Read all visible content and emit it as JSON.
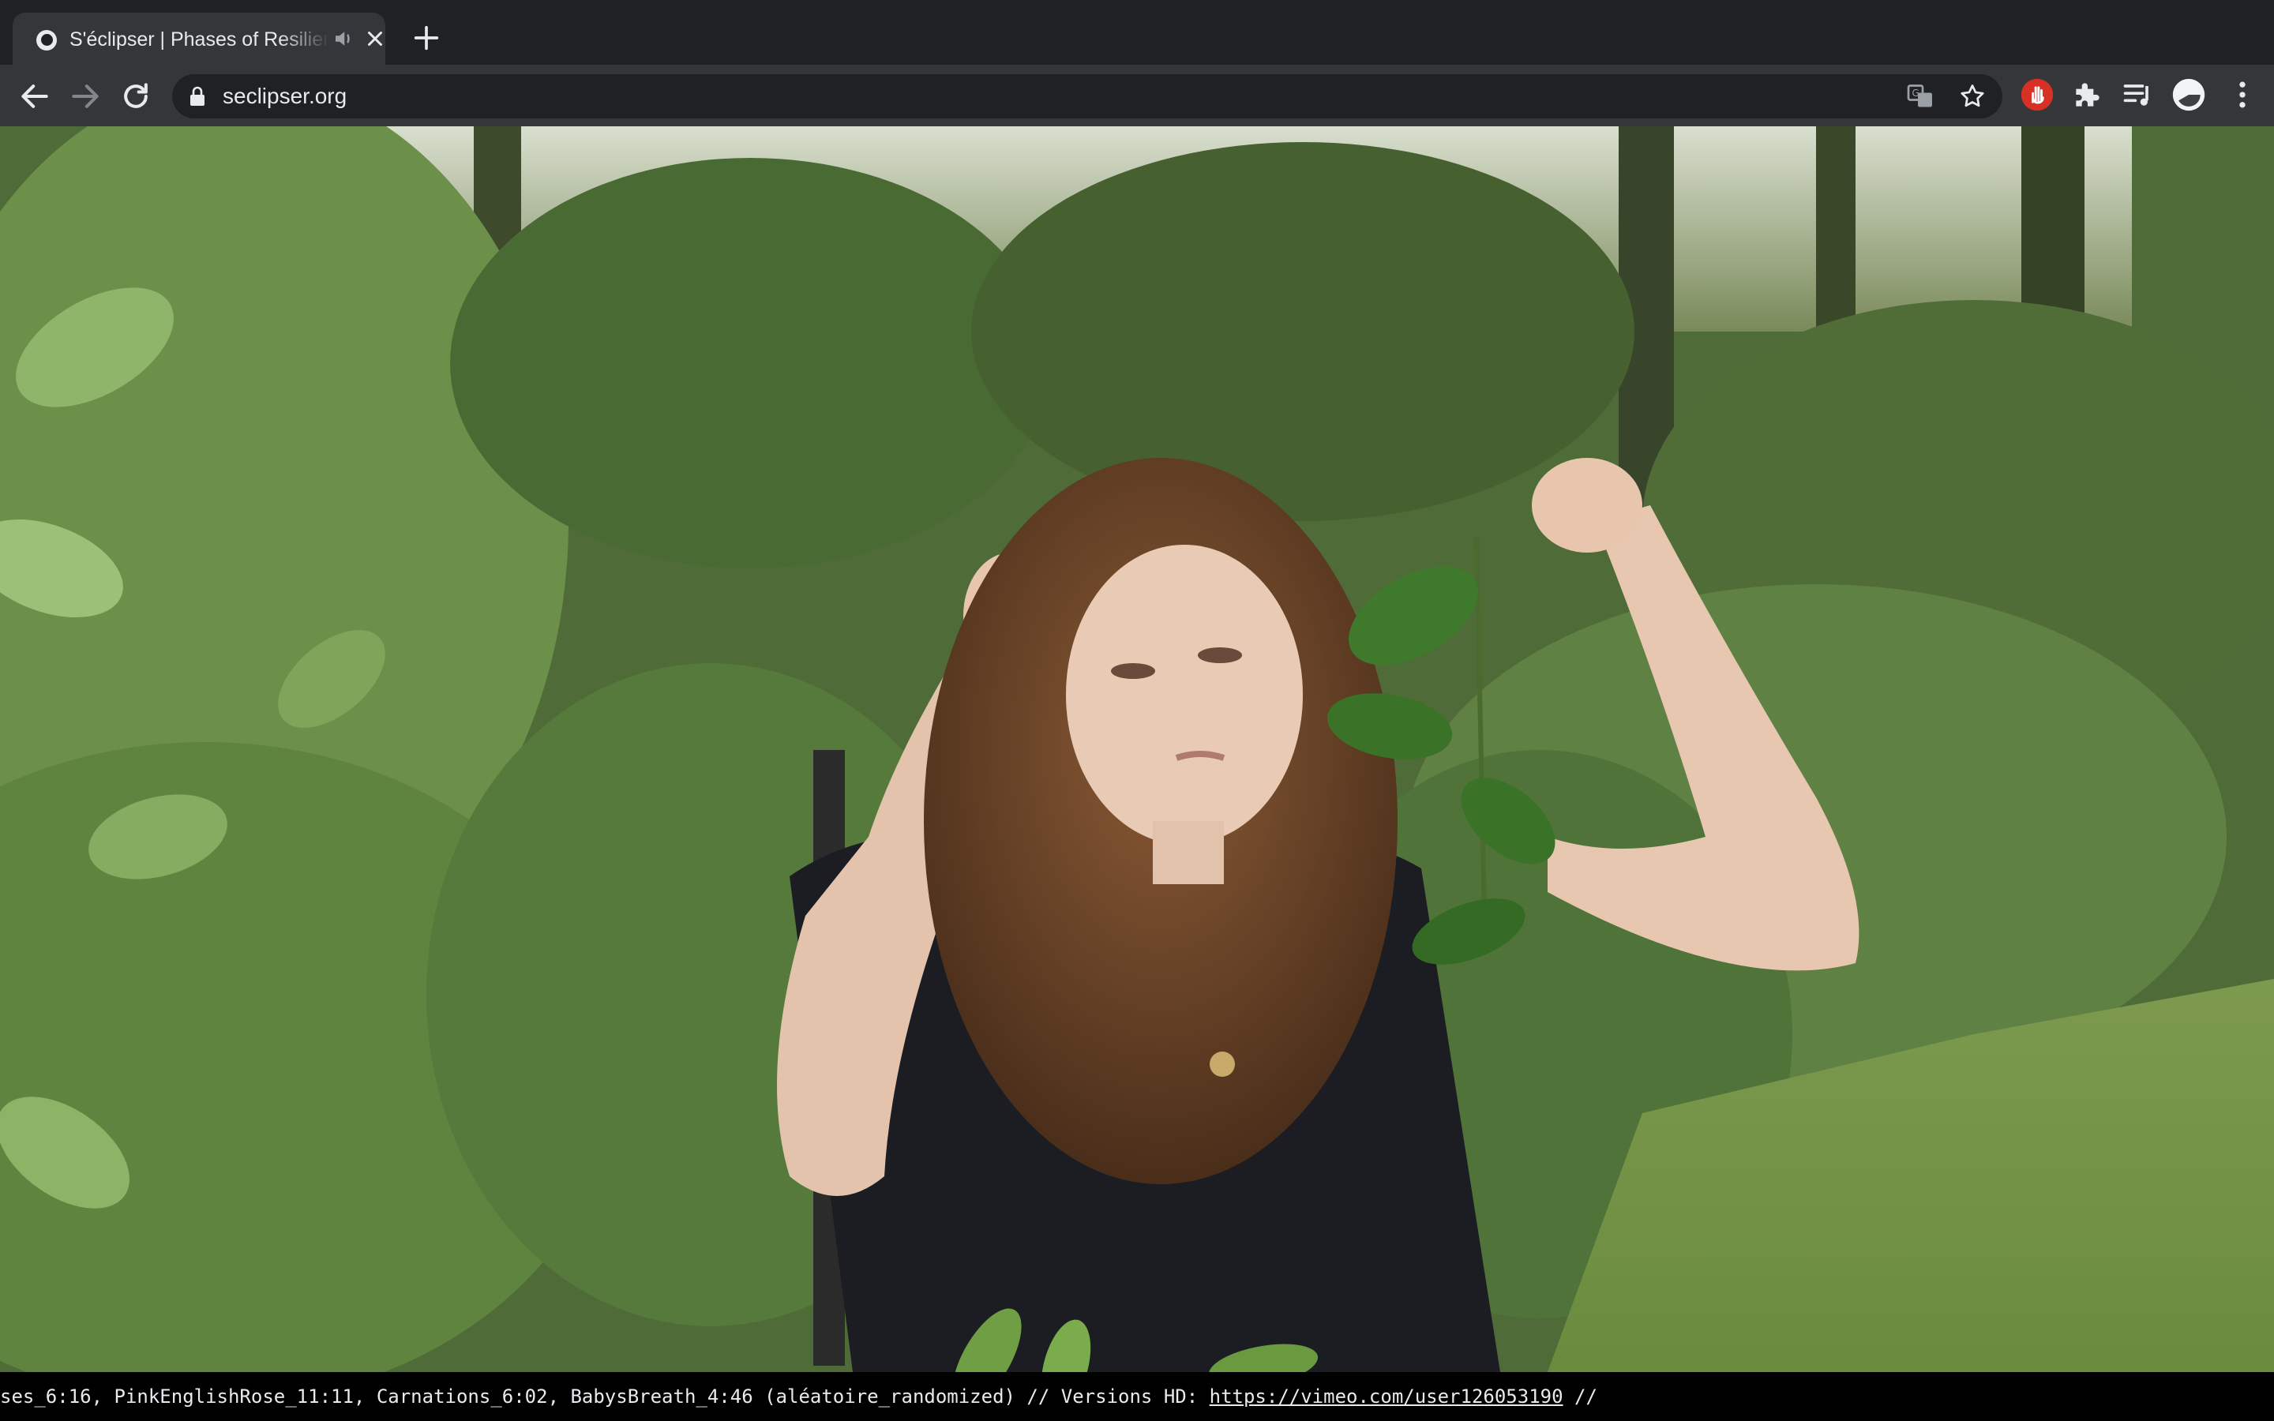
{
  "browser": {
    "tab": {
      "title": "S'éclipser | Phases of Resilience",
      "audio_icon": "speaker-icon",
      "close_icon": "close-icon"
    },
    "new_tab_icon": "plus-icon",
    "toolbar": {
      "back_icon": "arrow-left-icon",
      "forward_icon": "arrow-right-icon",
      "reload_icon": "reload-icon",
      "url": "seclipser.org",
      "translate_icon": "translate-icon",
      "bookmark_icon": "star-icon",
      "extensions": [
        "red-hand-icon",
        "puzzle-icon",
        "media-queue-icon",
        "avatar-icon",
        "more-vert-icon"
      ]
    }
  },
  "page": {
    "media": "video-frame",
    "footer": {
      "text": "ses_6:16, PinkEnglishRose_11:11, Carnations_6:02, BabysBreath_4:46 (aléatoire_randomized) // Versions HD: ",
      "link": "https://vimeo.com/user126053190",
      "trailing": " //"
    }
  },
  "colors": {
    "chrome_dark": "#202124",
    "chrome_toolbar": "#35363a",
    "text": "#e8eaed",
    "accent_red": "#d93025"
  }
}
